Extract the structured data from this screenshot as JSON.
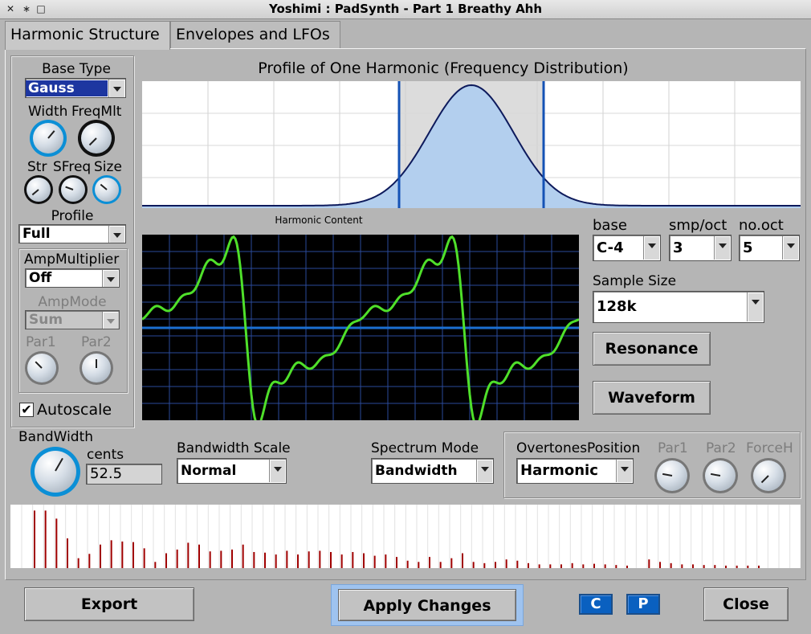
{
  "window": {
    "title": "Yoshimi : PadSynth - Part 1 Breathy Ahh",
    "controls": [
      "✕",
      "∗",
      "□"
    ]
  },
  "tabs": [
    {
      "label": "Harmonic Structure",
      "active": true
    },
    {
      "label": "Envelopes and LFOs",
      "active": false
    }
  ],
  "left_panel": {
    "base_type_label": "Base Type",
    "base_type_value": "Gauss",
    "width_label": "Width",
    "freqmlt_label": "FreqMlt",
    "str_label": "Str",
    "sfreq_label": "SFreq",
    "size_label": "Size",
    "profile_label": "Profile",
    "profile_value": "Full",
    "ampmultiplier_label": "AmpMultiplier",
    "ampmultiplier_value": "Off",
    "ampmode_label": "AmpMode",
    "ampmode_value": "Sum",
    "par1_label": "Par1",
    "par2_label": "Par2",
    "autoscale_label": "Autoscale",
    "autoscale_checked": true
  },
  "profile_graph": {
    "title": "Profile of One Harmonic (Frequency Distribution)",
    "fill_color": "#b3cfee",
    "line_color": "#0d1a5c",
    "marker_color": "#1452b5"
  },
  "harmonic_content": {
    "title": "Harmonic Content",
    "bg_color": "#000000",
    "grid_color": "#2a4a9a",
    "wave_color": "#4fe02a",
    "axis_color": "#1b6fd1"
  },
  "sample": {
    "base_label": "base",
    "base_value": "C-4",
    "smp_oct_label": "smp/oct",
    "smp_oct_value": "3",
    "no_oct_label": "no.oct",
    "no_oct_value": "5",
    "sample_size_label": "Sample Size",
    "sample_size_value": "128k",
    "resonance_label": "Resonance",
    "waveform_label": "Waveform"
  },
  "bandwidth": {
    "label": "BandWidth",
    "cents_label": "cents",
    "cents_value": "52.5",
    "scale_label": "Bandwidth Scale",
    "scale_value": "Normal",
    "spectrum_label": "Spectrum Mode",
    "spectrum_value": "Bandwidth",
    "overtones_label": "OvertonesPosition",
    "overtones_value": "Harmonic",
    "par1_label": "Par1",
    "par2_label": "Par2",
    "forceh_label": "ForceH"
  },
  "spectrum": {
    "bar_color": "#a00000",
    "heights": [
      0.93,
      0.93,
      0.8,
      0.48,
      0.16,
      0.23,
      0.38,
      0.45,
      0.43,
      0.42,
      0.32,
      0.1,
      0.24,
      0.3,
      0.41,
      0.38,
      0.27,
      0.28,
      0.3,
      0.38,
      0.26,
      0.25,
      0.22,
      0.28,
      0.22,
      0.27,
      0.28,
      0.26,
      0.22,
      0.26,
      0.24,
      0.2,
      0.22,
      0.18,
      0.12,
      0.1,
      0.18,
      0.1,
      0.16,
      0.24,
      0.1,
      0.08,
      0.1,
      0.14,
      0.12,
      0.08,
      0.06,
      0.06,
      0.06,
      0.08,
      0.06,
      0.07,
      0.06,
      0.05,
      0.04,
      0.0,
      0.14,
      0.1,
      0.08,
      0.06,
      0.06,
      0.05,
      0.05,
      0.04,
      0.04,
      0.04,
      0.04,
      0.0,
      0.0,
      0.0,
      0.0
    ]
  },
  "footer": {
    "export_label": "Export",
    "apply_label": "Apply Changes",
    "c_label": "C",
    "p_label": "P",
    "close_label": "Close"
  }
}
